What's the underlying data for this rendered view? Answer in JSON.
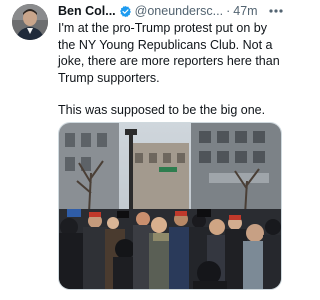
{
  "tweet": {
    "author_name": "Ben Col...",
    "handle": "@oneundersc...",
    "separator": "·",
    "time": "47m",
    "more_label": "•••",
    "text_paragraph_1": "I'm at the pro-Trump protest put on by the NY Young Republicans Club. Not a joke, there are more reporters here than Trump supporters.",
    "text_paragraph_2": "This was supposed to be the big one.",
    "verified_icon": "verified-badge-icon",
    "more_icon": "more-options-icon"
  },
  "colors": {
    "text_primary": "#0f1419",
    "text_secondary": "#536471",
    "verified_blue": "#1d9bf0",
    "media_border": "#cfd9de"
  }
}
